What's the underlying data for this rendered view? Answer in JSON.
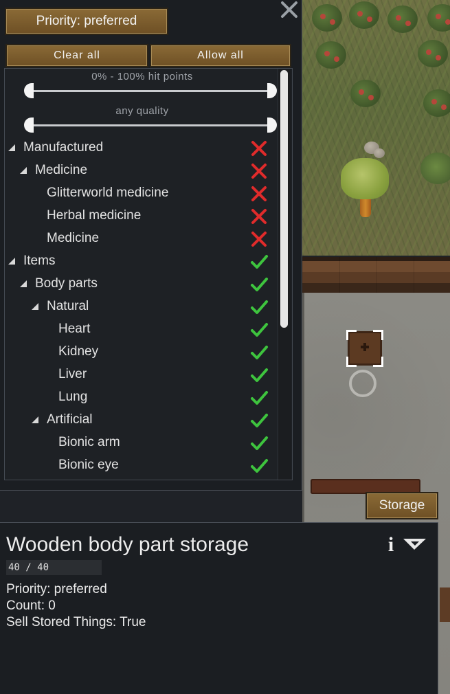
{
  "colors": {
    "panel_bg": "#1b1e22",
    "button_bg": "#7d5e2f",
    "allowed_check": "#3ec43e",
    "disallowed_x": "#e02b2b"
  },
  "filter_panel": {
    "priority_button": "Priority: preferred",
    "clear_all": "Clear all",
    "allow_all": "Allow all",
    "hit_points_caption": "0% - 100% hit points",
    "quality_caption": "any quality",
    "hit_points_range": [
      0,
      100
    ],
    "quality_range": [
      "min",
      "max"
    ],
    "tree": [
      {
        "label": "Manufactured",
        "depth": 0,
        "expandable": true,
        "allowed": false
      },
      {
        "label": "Medicine",
        "depth": 1,
        "expandable": true,
        "allowed": false
      },
      {
        "label": "Glitterworld medicine",
        "depth": 2,
        "expandable": false,
        "allowed": false
      },
      {
        "label": "Herbal medicine",
        "depth": 2,
        "expandable": false,
        "allowed": false
      },
      {
        "label": "Medicine",
        "depth": 2,
        "expandable": false,
        "allowed": false
      },
      {
        "label": "Items",
        "depth": 0,
        "expandable": true,
        "allowed": true
      },
      {
        "label": "Body parts",
        "depth": 1,
        "expandable": true,
        "allowed": true
      },
      {
        "label": "Natural",
        "depth": 2,
        "expandable": true,
        "allowed": true
      },
      {
        "label": "Heart",
        "depth": 3,
        "expandable": false,
        "allowed": true
      },
      {
        "label": "Kidney",
        "depth": 3,
        "expandable": false,
        "allowed": true
      },
      {
        "label": "Liver",
        "depth": 3,
        "expandable": false,
        "allowed": true
      },
      {
        "label": "Lung",
        "depth": 3,
        "expandable": false,
        "allowed": true
      },
      {
        "label": "Artificial",
        "depth": 2,
        "expandable": true,
        "allowed": true
      },
      {
        "label": "Bionic arm",
        "depth": 3,
        "expandable": false,
        "allowed": true
      },
      {
        "label": "Bionic eye",
        "depth": 3,
        "expandable": false,
        "allowed": true
      }
    ]
  },
  "storage_tab": "Storage",
  "info": {
    "title": "Wooden body part storage",
    "hit_points": "40 / 40",
    "lines": [
      "Priority: preferred",
      "Count: 0",
      "Sell Stored Things: True"
    ],
    "info_icon": "i"
  },
  "icons": {
    "close": "close-icon",
    "info": "info-icon",
    "collapse": "collapse-icon",
    "check": "check-icon",
    "cross": "cross-icon",
    "expand": "expand-triangle-icon"
  }
}
